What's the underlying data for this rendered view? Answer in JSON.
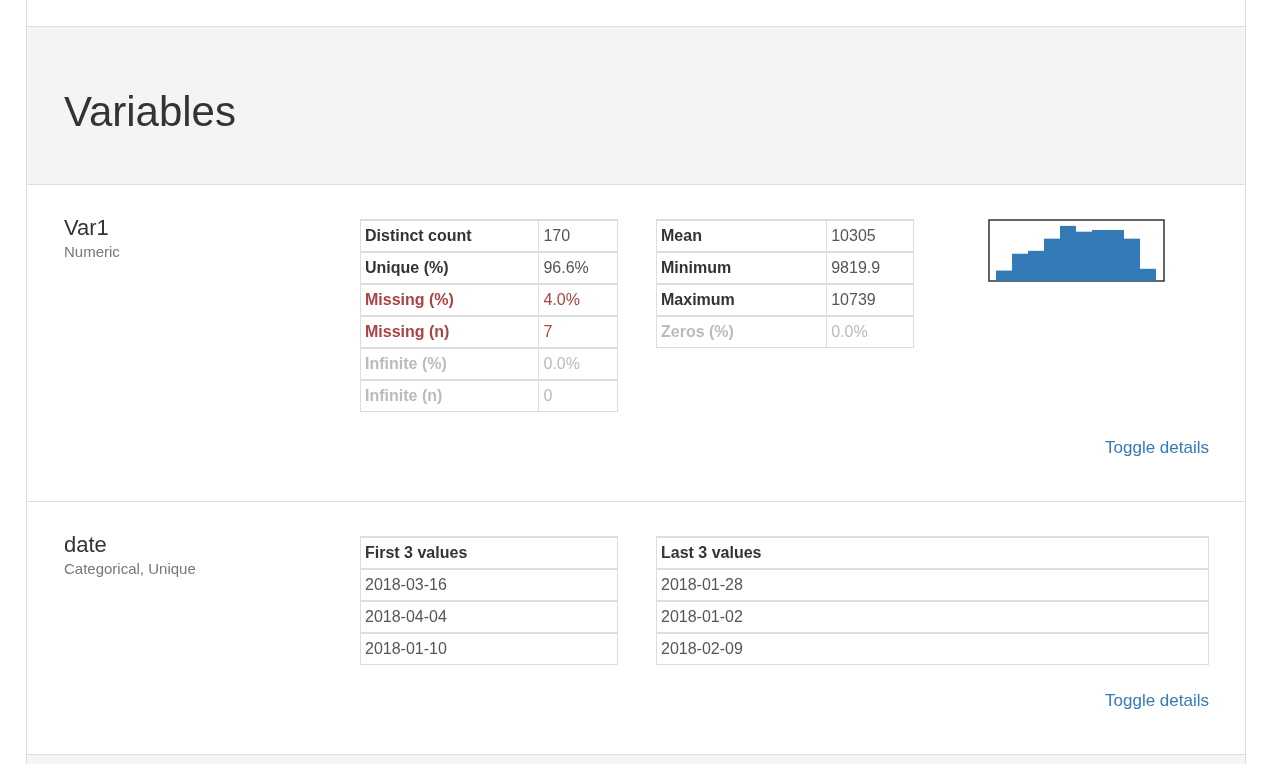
{
  "section_title": "Variables",
  "variables": [
    {
      "kind": "numeric",
      "name": "Var1",
      "type": "Numeric",
      "tables": [
        {
          "rows": [
            {
              "label": "Distinct count",
              "value": "170",
              "kind": "normal"
            },
            {
              "label": "Unique (%)",
              "value": "96.6%",
              "kind": "normal"
            },
            {
              "label": "Missing (%)",
              "value": "4.0%",
              "kind": "alert"
            },
            {
              "label": "Missing (n)",
              "value": "7",
              "kind": "alert"
            },
            {
              "label": "Infinite (%)",
              "value": "0.0%",
              "kind": "ignore"
            },
            {
              "label": "Infinite (n)",
              "value": "0",
              "kind": "ignore"
            }
          ]
        },
        {
          "rows": [
            {
              "label": "Mean",
              "value": "10305",
              "kind": "normal"
            },
            {
              "label": "Minimum",
              "value": "9819.9",
              "kind": "normal"
            },
            {
              "label": "Maximum",
              "value": "10739",
              "kind": "normal"
            },
            {
              "label": "Zeros (%)",
              "value": "0.0%",
              "kind": "ignore"
            }
          ]
        }
      ],
      "toggle": "Toggle details"
    },
    {
      "kind": "categorical",
      "name": "date",
      "type": "Categorical, Unique",
      "tables": [
        {
          "header": "First 3 values",
          "values": [
            "2018-03-16",
            "2018-04-04",
            "2018-01-10"
          ]
        },
        {
          "header": "Last 3 values",
          "values": [
            "2018-01-28",
            "2018-01-02",
            "2018-02-09"
          ]
        }
      ],
      "toggle": "Toggle details"
    }
  ]
}
